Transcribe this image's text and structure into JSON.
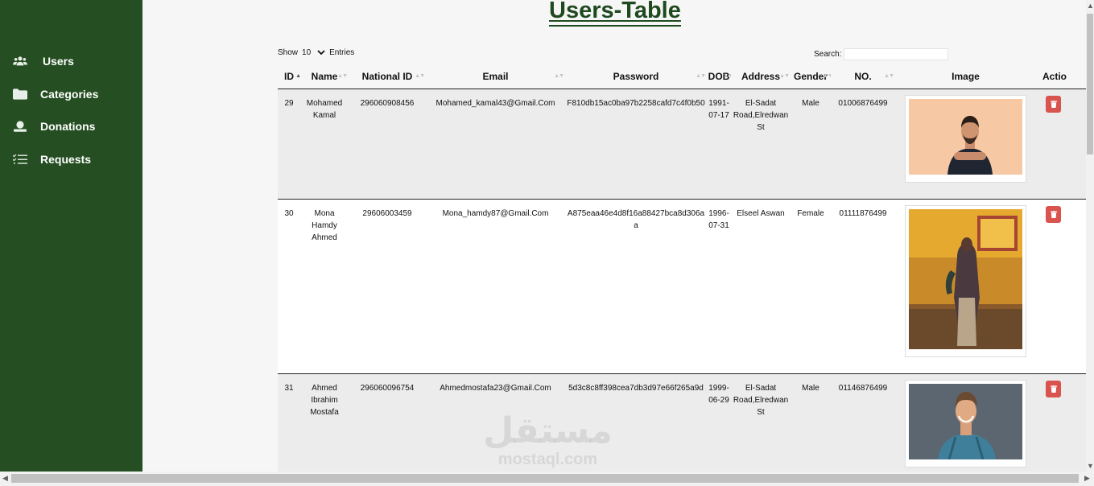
{
  "title": "Users-Table",
  "sidebar": {
    "items": [
      {
        "label": "Users",
        "icon": "users-icon"
      },
      {
        "label": "Categories",
        "icon": "folder-icon"
      },
      {
        "label": "Donations",
        "icon": "donation-icon"
      },
      {
        "label": "Requests",
        "icon": "list-check-icon"
      }
    ]
  },
  "controls": {
    "show_label": "Show",
    "entries_value": "10",
    "entries_label": "Entries",
    "search_label": "Search:",
    "search_value": ""
  },
  "table": {
    "headers": [
      "ID",
      "Name",
      "National ID",
      "Email",
      "Password",
      "DOB",
      "Address",
      "Gender",
      "NO.",
      "Image",
      "Actio"
    ],
    "rows": [
      {
        "id": "29",
        "name": "Mohamed Kamal",
        "national_id": "296060908456",
        "email": "Mohamed_kamal43@Gmail.Com",
        "password": "F810db15ac0ba97b2258cafd7c4f0b50",
        "dob": "1991-07-17",
        "address": "El-Sadat Road,Elredwan St",
        "gender": "Male",
        "no": "01006876499"
      },
      {
        "id": "30",
        "name": "Mona Hamdy Ahmed",
        "national_id": "29606003459",
        "email": "Mona_hamdy87@Gmail.Com",
        "password": "A875eaa46e4d8f16a88427bca8d306aa",
        "dob": "1996-07-31",
        "address": "Elseel Aswan",
        "gender": "Female",
        "no": "01111876499"
      },
      {
        "id": "31",
        "name": "Ahmed Ibrahim Mostafa",
        "national_id": "296060096754",
        "email": "Ahmedmostafa23@Gmail.Com",
        "password": "5d3c8c8ff398cea7db3d97e66f265a9d",
        "dob": "1999-06-29",
        "address": "El-Sadat Road,Elredwan St",
        "gender": "Male",
        "no": "01146876499"
      }
    ]
  },
  "watermark": {
    "arabic": "مستقل",
    "latin": "mostaql.com"
  },
  "colors": {
    "sidebar": "#254f22",
    "title": "#1f4a1f",
    "delete_button": "#d9534f"
  }
}
